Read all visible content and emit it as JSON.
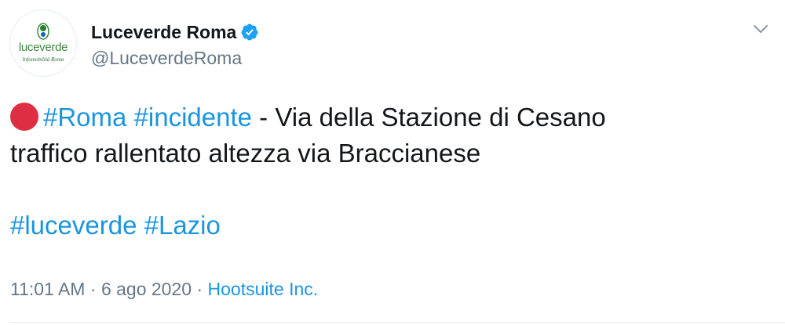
{
  "author": {
    "avatar": {
      "logo_text": "luceverde",
      "logo_subtitle": "Infomobilità Roma",
      "logo_color": "#3a8a3a"
    },
    "display_name": "Luceverde Roma",
    "verified": true,
    "verified_icon": "verified-badge-icon",
    "handle": "@LuceverdeRoma"
  },
  "menu": {
    "icon": "chevron-down-icon"
  },
  "tweet": {
    "emoji": "red-circle-icon",
    "line1": {
      "hashtag1": "#Roma",
      "hashtag2": "#incidente",
      "text": " - Via della Stazione di Cesano"
    },
    "line2": "traffico rallentato altezza via Braccianese",
    "line4": {
      "hashtag1": "#luceverde",
      "hashtag2": "#Lazio"
    }
  },
  "meta": {
    "time": "11:01 AM",
    "separator": " · ",
    "date": "6 ago 2020",
    "source": "Hootsuite Inc."
  },
  "colors": {
    "link": "#1b95e0",
    "text": "#14171a",
    "secondary": "#657786",
    "verified": "#1da1f2",
    "red_circle": "#dd2e44"
  }
}
